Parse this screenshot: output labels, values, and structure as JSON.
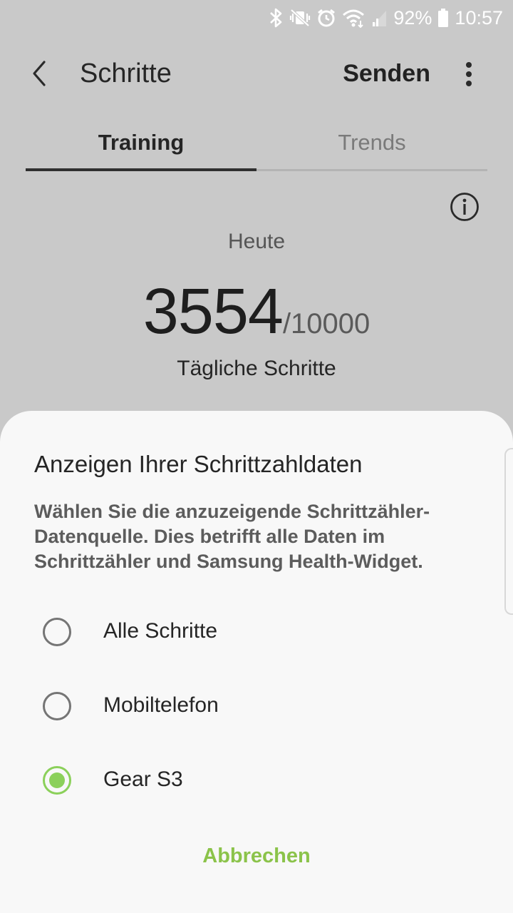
{
  "status_bar": {
    "battery": "92%",
    "time": "10:57",
    "icons": [
      "bluetooth-icon",
      "vibrate-mute-icon",
      "alarm-icon",
      "wifi-icon",
      "signal-icon",
      "battery-icon"
    ]
  },
  "app_bar": {
    "title": "Schritte",
    "send_label": "Senden",
    "icons": [
      "back-arrow-icon",
      "more-vert-icon"
    ]
  },
  "tabs": [
    {
      "label": "Training",
      "selected": true
    },
    {
      "label": "Trends",
      "selected": false
    }
  ],
  "summary": {
    "day": "Heute",
    "steps": "3554",
    "goal": "/10000",
    "label": "Tägliche Schritte"
  },
  "sheet": {
    "title": "Anzeigen Ihrer Schrittzahldaten",
    "description": "Wählen Sie die anzuzeigende Schrittzähler-Datenquelle. Dies betrifft alle Daten im Schrittzähler und Samsung Health-Widget.",
    "options": [
      {
        "label": "Alle Schritte",
        "selected": false
      },
      {
        "label": "Mobiltelefon",
        "selected": false
      },
      {
        "label": "Gear S3",
        "selected": true
      }
    ],
    "cancel_label": "Abbrechen"
  },
  "colors": {
    "accent": "#8bd05a",
    "cancel_text": "#8bc34a",
    "dim_background": "#c9c9c9",
    "sheet_background": "#f8f8f8"
  }
}
